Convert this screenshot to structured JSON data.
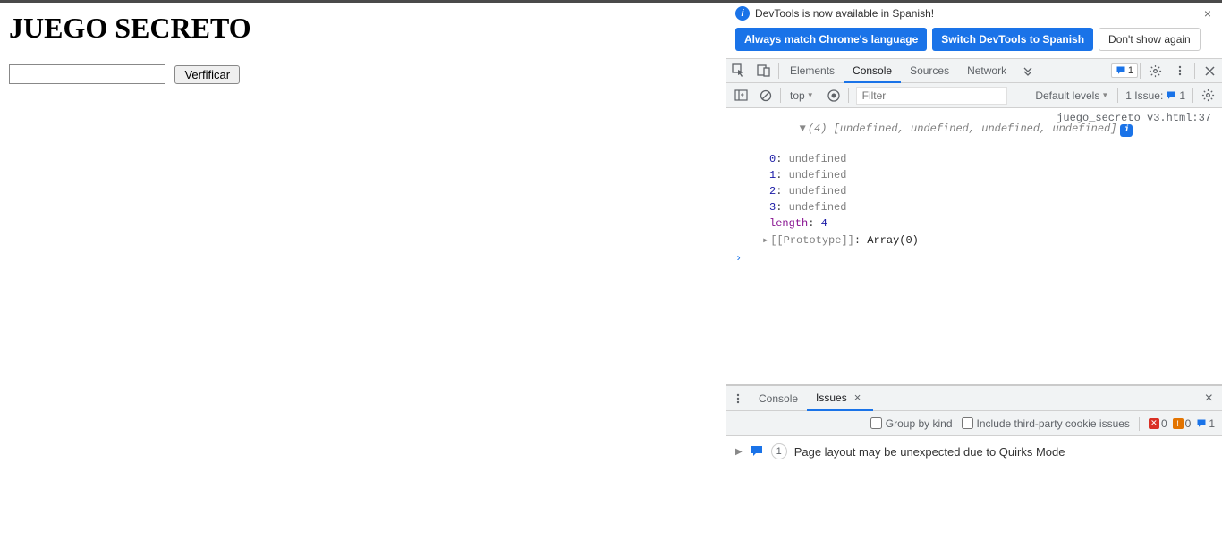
{
  "page": {
    "title": "JUEGO SECRETO",
    "input_value": "",
    "button_label": "Verfificar"
  },
  "banner": {
    "text": "DevTools is now available in Spanish!",
    "btn_always": "Always match Chrome's language",
    "btn_switch": "Switch DevTools to Spanish",
    "btn_dont": "Don't show again"
  },
  "tabs": {
    "elements": "Elements",
    "console": "Console",
    "sources": "Sources",
    "network": "Network",
    "badge_count": "1"
  },
  "toolbar": {
    "context": "top",
    "filter_placeholder": "Filter",
    "levels": "Default levels",
    "issues_label": "1 Issue:",
    "issues_count": "1"
  },
  "console": {
    "source_link": "juego_secreto v3.html:37",
    "array_header_count": "(4)",
    "array_header_body": "[undefined, undefined, undefined, undefined]",
    "entries": [
      {
        "key": "0",
        "value": "undefined"
      },
      {
        "key": "1",
        "value": "undefined"
      },
      {
        "key": "2",
        "value": "undefined"
      },
      {
        "key": "3",
        "value": "undefined"
      }
    ],
    "length_key": "length",
    "length_value": "4",
    "prototype_label": "[[Prototype]]",
    "prototype_value": "Array(0)",
    "prompt": "›"
  },
  "drawer": {
    "tab_console": "Console",
    "tab_issues": "Issues",
    "group_by_kind": "Group by kind",
    "include_third_party": "Include third-party cookie issues",
    "counts": {
      "red": "0",
      "yellow": "0",
      "blue": "1"
    },
    "issue_count": "1",
    "issue_text": "Page layout may be unexpected due to Quirks Mode"
  }
}
